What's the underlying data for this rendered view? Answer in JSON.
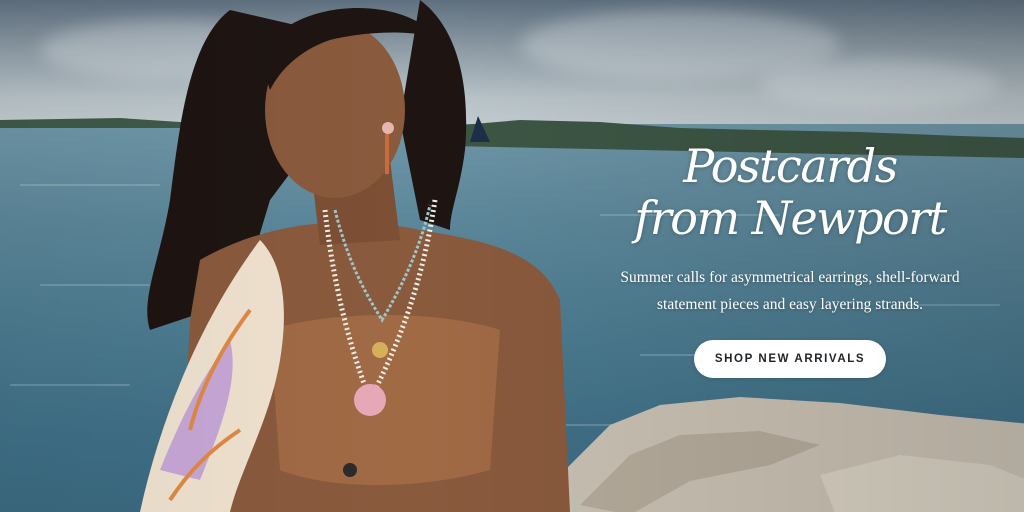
{
  "hero": {
    "headline_line1": "Postcards",
    "headline_line2": "from Newport",
    "subcopy_line1": "Summer calls for asymmetrical earrings, shell-forward",
    "subcopy_line2": "statement pieces and easy layering strands.",
    "cta_label": "SHOP NEW ARRIVALS"
  },
  "colors": {
    "text": "#ffffff",
    "cta_background": "#ffffff",
    "cta_text": "#1f2326",
    "sea": "#4b7a8f",
    "sky": "#b9c4c9"
  }
}
